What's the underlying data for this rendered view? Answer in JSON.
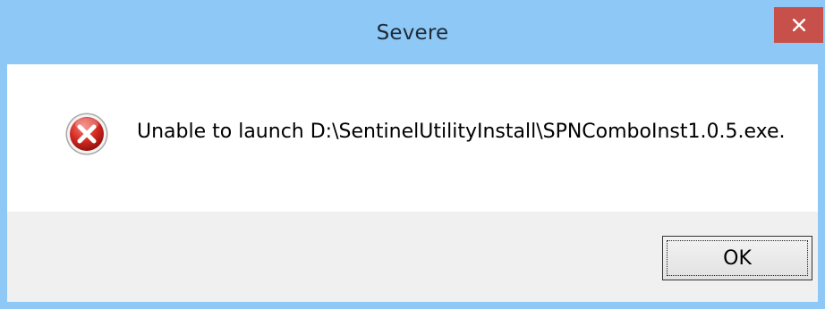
{
  "window": {
    "title": "Severe",
    "close_icon": "close-icon"
  },
  "dialog": {
    "icon": "error-icon",
    "message": "Unable to launch D:\\SentinelUtilityInstall\\SPNComboInst1.0.5.exe."
  },
  "buttons": {
    "ok_label": "OK"
  },
  "colors": {
    "titlebar": "#8ec8f7",
    "close_button": "#c7504a",
    "button_area": "#f0f0f0",
    "error_red": "#c1121a"
  }
}
